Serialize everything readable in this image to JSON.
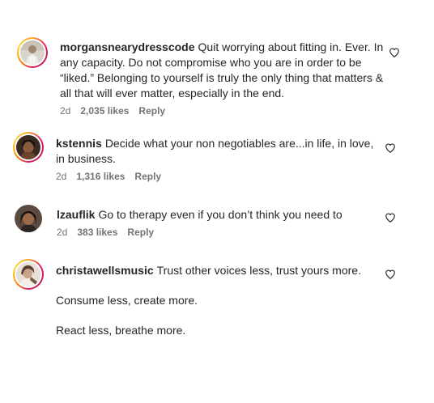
{
  "comments": [
    {
      "username": "morgansnearydresscode",
      "text": "Quit worrying about fitting in. Ever. In any capacity. Do not compromise who you are in order to be “liked.” Belonging to yourself is truly the only thing that matters & all that will ever matter, especially in the end.",
      "time": "2d",
      "likes": "2,035 likes",
      "reply": "Reply",
      "avatar_icon": "profile-photo"
    },
    {
      "username": "kstennis",
      "text": "Decide what your non negotiables are...in life, in love, in business.",
      "time": "2d",
      "likes": "1,316 likes",
      "reply": "Reply",
      "avatar_icon": "profile-photo"
    },
    {
      "username": "lzauflik",
      "text": "Go to therapy even if you don’t think you need to",
      "time": "2d",
      "likes": "383 likes",
      "reply": "Reply",
      "avatar_icon": "profile-photo"
    },
    {
      "username": "christawellsmusic",
      "text": "Trust other voices less, trust yours more.",
      "text2": "Consume less, create more.",
      "text3": "React less, breathe more.",
      "avatar_icon": "profile-photo"
    }
  ],
  "colors": {
    "text": "#262626",
    "meta": "#737373",
    "story_ring": "#e91e63"
  }
}
